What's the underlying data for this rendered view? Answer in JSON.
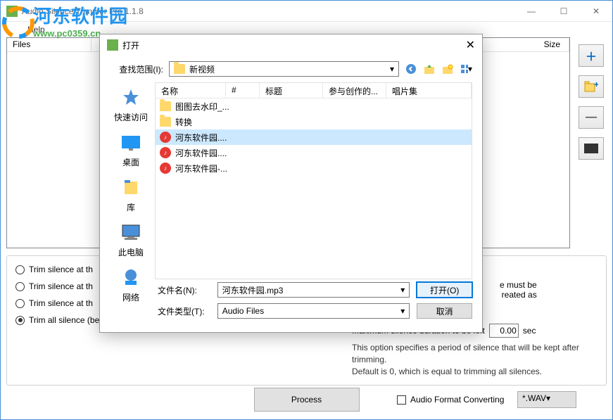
{
  "window": {
    "title": "Audio Silence Trimmer Pro 1.1.8"
  },
  "menu": {
    "help": "Help"
  },
  "watermark": {
    "title": "河东软件园",
    "url": "www.pc0359.cn"
  },
  "main_list": {
    "files_col": "Files",
    "size_col": "Size"
  },
  "options": {
    "opt1": "Trim silence at th",
    "opt2": "Trim silence at th",
    "opt3": "Trim silence at th",
    "opt4": "Trim all silence (beginning, middle and end)",
    "selected": 3,
    "max_label": "Maximum silence duration to be left",
    "max_value": "0.00",
    "sec": "sec",
    "info1": "This option specifies a period of silence that will be kept after trimming.",
    "info2": "Default is 0, which is equal to trimming all silences.",
    "hint1": "e must be",
    "hint2": "reated as"
  },
  "process_btn": "Process",
  "afc_label": "Audio Format Converting",
  "wav_sel": "*.WAV",
  "dialog": {
    "title": "打开",
    "lookin_label": "查找范围(I):",
    "lookin_value": "新视频",
    "places": {
      "quick": "快速访问",
      "desktop": "桌面",
      "lib": "库",
      "pc": "此电脑",
      "net": "网络"
    },
    "cols": {
      "name": "名称",
      "num": "#",
      "title": "标题",
      "contrib": "参与创作的...",
      "album": "唱片集"
    },
    "rows": [
      {
        "type": "folder",
        "name": "图图去水印_..."
      },
      {
        "type": "folder",
        "name": "转换"
      },
      {
        "type": "audio",
        "name": "河东软件园....",
        "selected": true
      },
      {
        "type": "audio",
        "name": "河东软件园...."
      },
      {
        "type": "audio",
        "name": "河东软件园-..."
      }
    ],
    "filename_label": "文件名(N):",
    "filename_value": "河东软件园.mp3",
    "filetype_label": "文件类型(T):",
    "filetype_value": "Audio Files",
    "open_btn": "打开(O)",
    "cancel_btn": "取消"
  }
}
